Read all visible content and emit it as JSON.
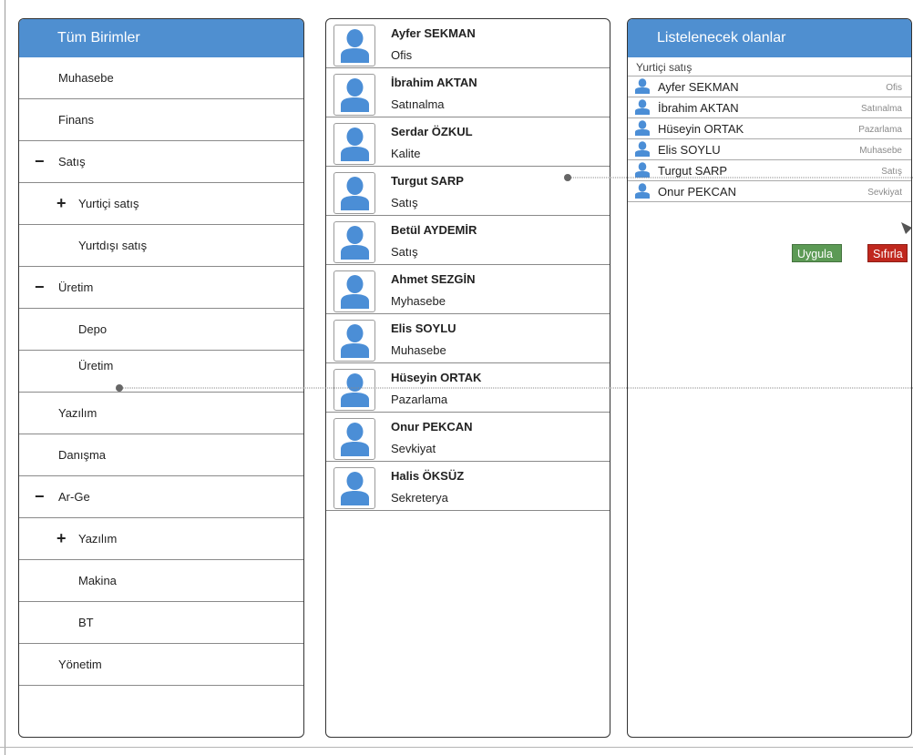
{
  "left_panel": {
    "title": "Tüm Birimler",
    "items": [
      {
        "label": "Muhasebe",
        "toggle": ""
      },
      {
        "label": "Finans",
        "toggle": ""
      },
      {
        "label": "Satış",
        "toggle": "−"
      },
      {
        "label": "Yurtiçi satış",
        "toggle": "+"
      },
      {
        "label": "Yurtdışı satış",
        "toggle": ""
      },
      {
        "label": "Üretim",
        "toggle": "−"
      },
      {
        "label": "Depo",
        "toggle": ""
      },
      {
        "label": "Üretim",
        "toggle": ""
      },
      {
        "label": "Yazılım",
        "toggle": ""
      },
      {
        "label": "Danışma",
        "toggle": ""
      },
      {
        "label": "Ar-Ge",
        "toggle": "−"
      },
      {
        "label": "Yazılım",
        "toggle": "+"
      },
      {
        "label": "Makina",
        "toggle": ""
      },
      {
        "label": "BT",
        "toggle": ""
      },
      {
        "label": "Yönetim",
        "toggle": ""
      }
    ]
  },
  "middle_panel": {
    "people": [
      {
        "name": "Ayfer SEKMAN",
        "dept": "Ofis"
      },
      {
        "name": "İbrahim AKTAN",
        "dept": "Satınalma"
      },
      {
        "name": "Serdar ÖZKUL",
        "dept": "Kalite"
      },
      {
        "name": "Turgut SARP",
        "dept": "Satış"
      },
      {
        "name": "Betül AYDEMİR",
        "dept": "Satış"
      },
      {
        "name": "Ahmet SEZGİN",
        "dept": "Myhasebe"
      },
      {
        "name": "Elis SOYLU",
        "dept": "Muhasebe"
      },
      {
        "name": "Hüseyin ORTAK",
        "dept": "Pazarlama"
      },
      {
        "name": "Onur PEKCAN",
        "dept": "Sevkiyat"
      },
      {
        "name": "Halis ÖKSÜZ",
        "dept": "Sekreterya"
      }
    ]
  },
  "right_panel": {
    "title": "Listelenecek olanlar",
    "group_label": "Yurtiçi satış",
    "rows": [
      {
        "name": "Ayfer SEKMAN",
        "dept": "Ofis"
      },
      {
        "name": "İbrahim AKTAN",
        "dept": "Satınalma"
      },
      {
        "name": "Hüseyin ORTAK",
        "dept": "Pazarlama"
      },
      {
        "name": "Elis SOYLU",
        "dept": "Muhasebe"
      },
      {
        "name": "Turgut SARP",
        "dept": "Satış"
      },
      {
        "name": "Onur PEKCAN",
        "dept": "Sevkiyat"
      }
    ],
    "apply_label": "Uygula",
    "reset_label": "Sıfırla"
  },
  "colors": {
    "header_blue": "#4f8fd0",
    "avatar_blue": "#4b8ed6",
    "apply_green": "#5c9a55",
    "reset_red": "#c0281e"
  },
  "icons": {
    "avatar": "user-silhouette-icon",
    "row_user": "user-icon"
  }
}
